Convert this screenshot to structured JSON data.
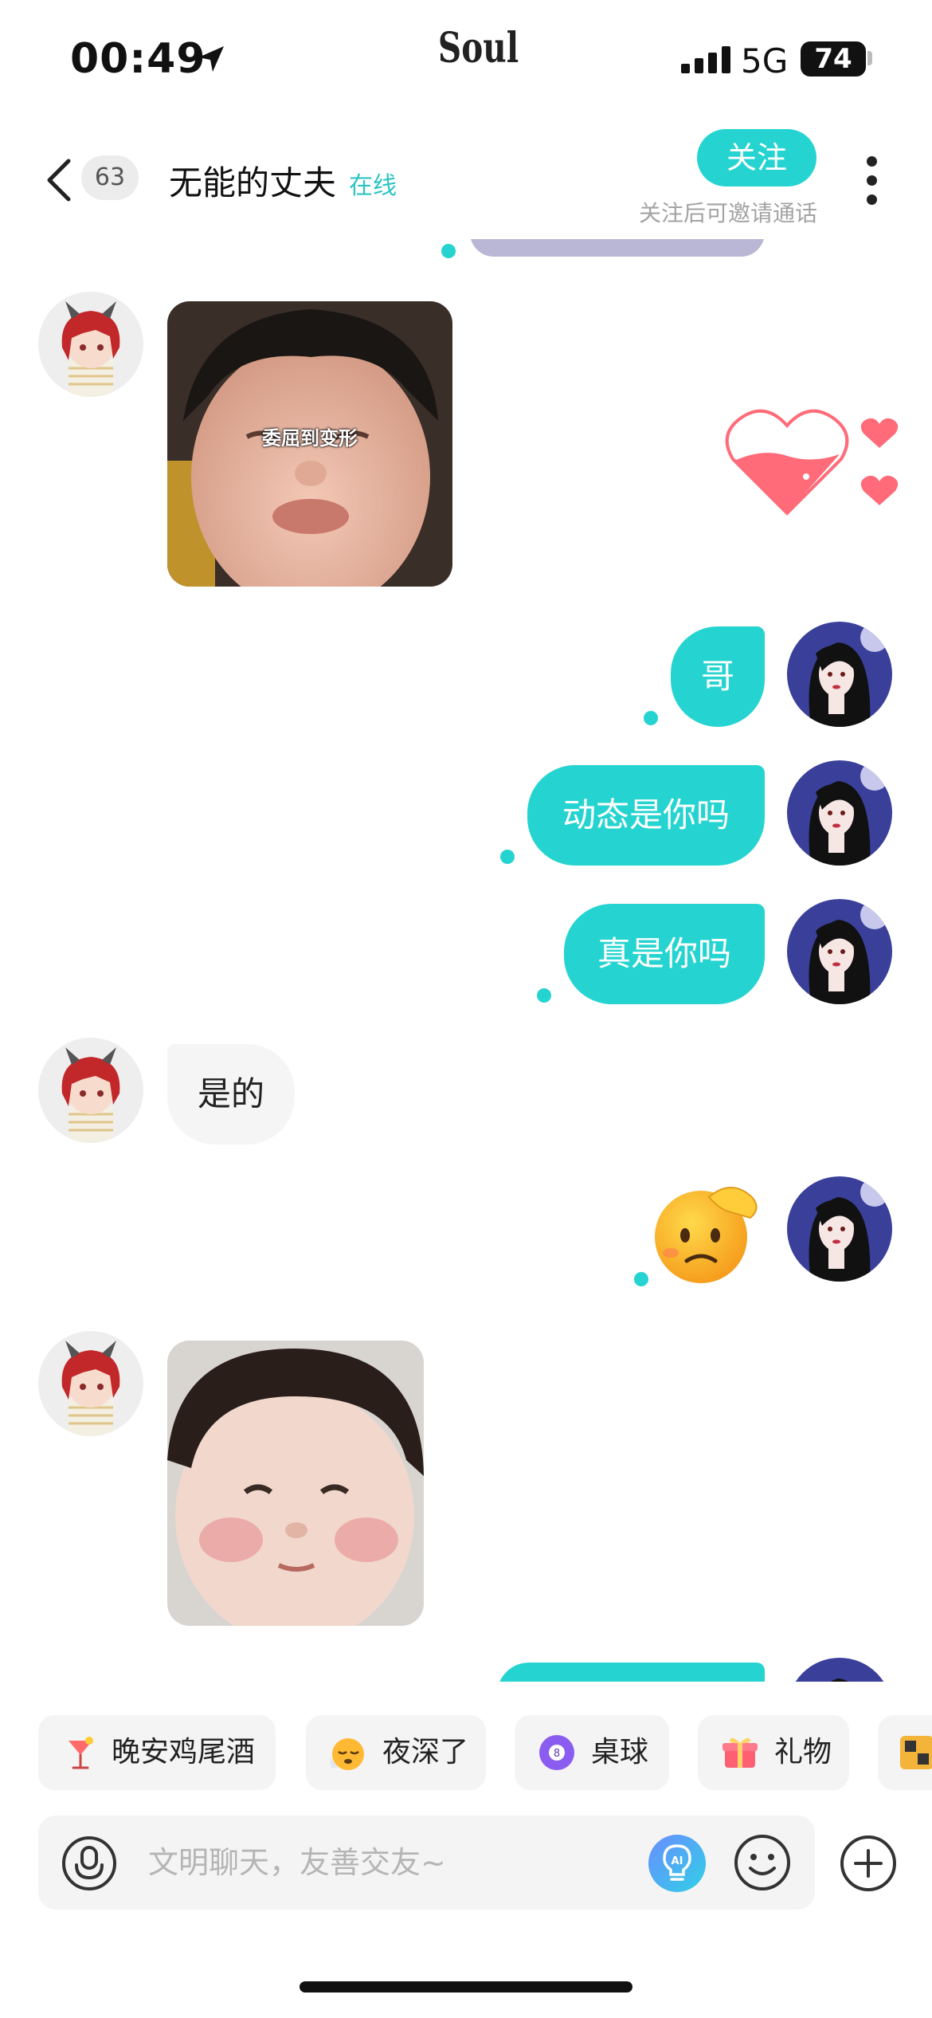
{
  "status_bar": {
    "time": "00:49",
    "app_name": "Soul",
    "network": "5G",
    "battery": "74"
  },
  "header": {
    "unread_count": "63",
    "peer_name": "无能的丈夫",
    "peer_status": "在线",
    "follow_label": "关注",
    "follow_hint": "关注后可邀请通话"
  },
  "messages": [
    {
      "side": "in",
      "type": "image",
      "caption": "委屈到变形"
    },
    {
      "side": "out",
      "type": "text",
      "text": "哥"
    },
    {
      "side": "out",
      "type": "text",
      "text": "动态是你吗"
    },
    {
      "side": "out",
      "type": "text",
      "text": "真是你吗"
    },
    {
      "side": "in",
      "type": "text",
      "text": "是的"
    },
    {
      "side": "out",
      "type": "emoji",
      "text": "🥴"
    },
    {
      "side": "in",
      "type": "image",
      "caption": ""
    }
  ],
  "quick_chips": [
    {
      "label": "晚安鸡尾酒",
      "icon": "cocktail-icon"
    },
    {
      "label": "夜深了",
      "icon": "sleepy-face-icon"
    },
    {
      "label": "桌球",
      "icon": "billiard-ball-icon"
    },
    {
      "label": "礼物",
      "icon": "gift-icon"
    }
  ],
  "input": {
    "placeholder": "文明聊天，友善交友~"
  },
  "colors": {
    "accent": "#25d4d0",
    "incoming_bubble": "#f5f5f5",
    "heart": "#ff6b78"
  }
}
